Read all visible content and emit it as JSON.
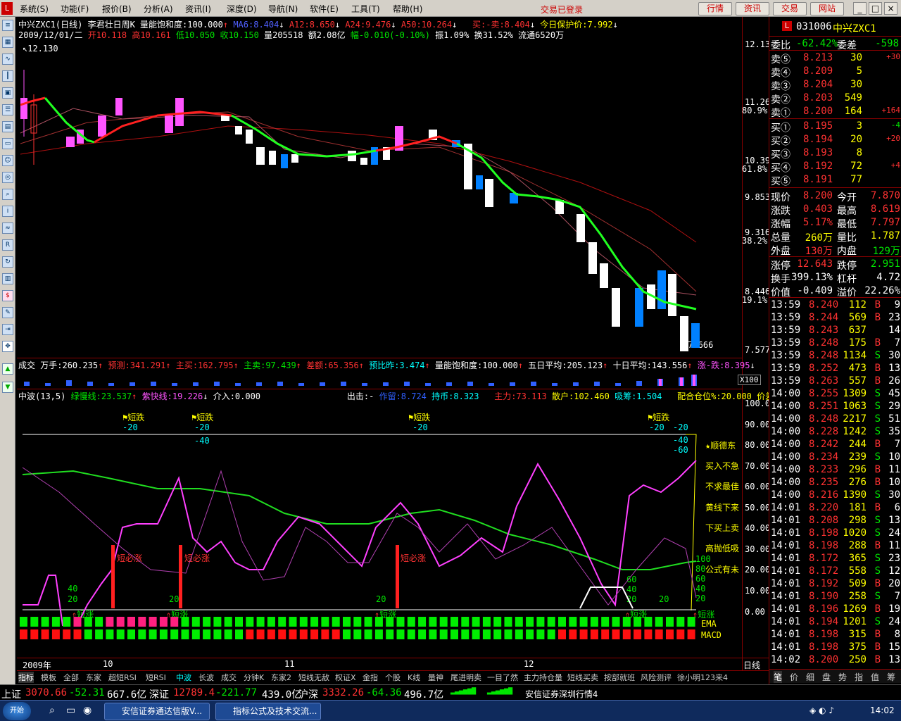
{
  "menu": {
    "items": [
      "系统(S)",
      "功能(F)",
      "报价(B)",
      "分析(A)",
      "资讯(I)",
      "深度(D)",
      "导航(N)",
      "软件(E)",
      "工具(T)",
      "帮助(H)"
    ],
    "trade_status": "交易已登录",
    "buttons": [
      "行情",
      "资讯",
      "交易",
      "网站"
    ]
  },
  "chart_header": {
    "line1": {
      "title": "中兴ZXC1(日线) 李君壮日周K",
      "saturation": "量能饱和度:100.000",
      "ma6": "MA6:8.404",
      "a12": "A12:8.650",
      "a24": "A24:9.476",
      "a50": "A50:10.264",
      "buysell": "买:-卖:8.404",
      "protect": "今日保护价:7.992"
    },
    "line2": {
      "date": "2009/12/01/二",
      "open": "开10.118",
      "high": "高10.161",
      "low": "低10.050",
      "close": "收10.150",
      "vol": "量205518",
      "amount": "额2.08亿",
      "change": "幅-0.010(-0.10%)",
      "amp": "振1.09%",
      "turnover": "换31.52%",
      "float": "流通6520万"
    },
    "high_marker": "12.130",
    "low_marker": "7.666"
  },
  "price_axis": [
    {
      "v": "12.13"
    },
    {
      "v": "11.26",
      "p": "80.9%"
    },
    {
      "v": "10.39",
      "p": "61.8%"
    },
    {
      "v": "9.853"
    },
    {
      "v": "9.316",
      "p": "38.2%"
    },
    {
      "v": "8.446",
      "p": "19.1%"
    },
    {
      "v": "7.577"
    }
  ],
  "vol_header": {
    "label": "成交",
    "wanshou": "万手:260.235",
    "predict": "预测:341.291",
    "mainbuy": "主买:162.795",
    "mainsell": "主卖:97.439",
    "diff": "差额:65.356",
    "ratio": "预比昨:3.474",
    "sat": "量能饱和度:100.000",
    "ma5": "五日平均:205.123",
    "ma10": "十日平均:143.556",
    "rise": "涨-跌:8.395",
    "x100": "X100"
  },
  "ind_header": {
    "name": "中波(13,5)",
    "green": "绿慢线:23.537",
    "purple": "紫快线:19.226",
    "enter": "介入:0.000",
    "out": "出击:-",
    "work": "作留:8.724",
    "hold": "持币:8.323",
    "main": "主力:73.113",
    "retail": "散户:102.460",
    "absorb": "吸筹:1.504",
    "pos": "配合仓位%:20.000",
    "pdiff": "价差20:-4."
  },
  "ind_axis": [
    "100.0",
    "90.00",
    "80.00",
    "70.00",
    "60.00",
    "50.00",
    "40.00",
    "30.00",
    "20.00",
    "10.00",
    "0.00"
  ],
  "ind_signals": {
    "short_fall": "短跌",
    "short_rise": "短涨",
    "must_rise": "短必涨",
    "m20": "-20",
    "m40": "-40",
    "m60": "-60",
    "p20": "20",
    "p40": "40",
    "p60": "60",
    "p80": "80",
    "p100": "100",
    "ema": "EMA",
    "macd": "MACD"
  },
  "ind_notes": [
    "★顺德东",
    "买入不急",
    "不求最佳",
    "黄线下来",
    "下买上卖",
    "高抛低吸",
    "公式有未"
  ],
  "time_axis": {
    "year": "2009年",
    "m10": "10",
    "m11": "11",
    "m12": "12",
    "period": "日线"
  },
  "bottom_tabs": [
    "指标",
    "模板",
    "全部",
    "东家",
    "超短RSI",
    "短RSI",
    "中波",
    "长波",
    "成交",
    "分钟K",
    "东家2",
    "短线无敌",
    "权证X",
    "金指",
    "个股",
    "K线",
    "量神",
    "尾进明卖",
    "一目了然",
    "主力持仓量",
    "短线买卖",
    "按部就班",
    "风险测评",
    "徐小明123来4"
  ],
  "quote": {
    "code": "031006",
    "name": "中兴ZXC1",
    "committee": {
      "ratio_label": "委比",
      "ratio": "-62.42%",
      "diff_label": "委差",
      "diff": "-598"
    },
    "asks": [
      {
        "l": "卖⑤",
        "p": "8.213",
        "v": "30",
        "c": "+30"
      },
      {
        "l": "卖④",
        "p": "8.209",
        "v": "5",
        "c": ""
      },
      {
        "l": "卖③",
        "p": "8.204",
        "v": "30",
        "c": ""
      },
      {
        "l": "卖②",
        "p": "8.203",
        "v": "549",
        "c": ""
      },
      {
        "l": "卖①",
        "p": "8.200",
        "v": "164",
        "c": "+164"
      }
    ],
    "bids": [
      {
        "l": "买①",
        "p": "8.195",
        "v": "3",
        "c": "-4"
      },
      {
        "l": "买②",
        "p": "8.194",
        "v": "20",
        "c": "+20"
      },
      {
        "l": "买③",
        "p": "8.193",
        "v": "8",
        "c": ""
      },
      {
        "l": "买④",
        "p": "8.192",
        "v": "72",
        "c": "+4"
      },
      {
        "l": "买⑤",
        "p": "8.191",
        "v": "77",
        "c": ""
      }
    ],
    "stats": [
      {
        "l1": "现价",
        "v1": "8.200",
        "l2": "今开",
        "v2": "7.870"
      },
      {
        "l1": "涨跌",
        "v1": "0.403",
        "l2": "最高",
        "v2": "8.619"
      },
      {
        "l1": "涨幅",
        "v1": "5.17%",
        "l2": "最低",
        "v2": "7.797"
      },
      {
        "l1": "总量",
        "v1": "260万",
        "l2": "量比",
        "v2": "1.787"
      },
      {
        "l1": "外盘",
        "v1": "130万",
        "l2": "内盘",
        "v2": "129万"
      }
    ],
    "stats2": [
      {
        "l1": "涨停",
        "v1": "12.643",
        "l2": "跌停",
        "v2": "2.951"
      },
      {
        "l1": "换手",
        "v1": "399.13%",
        "l2": "杠杆",
        "v2": "4.72"
      },
      {
        "l1": "价值",
        "v1": "-0.409",
        "l2": "溢价",
        "v2": "22.26%"
      }
    ],
    "ticks": [
      {
        "t": "13:59",
        "p": "8.240",
        "v": "112",
        "d": "B",
        "n": "9"
      },
      {
        "t": "13:59",
        "p": "8.244",
        "v": "569",
        "d": "B",
        "n": "23"
      },
      {
        "t": "13:59",
        "p": "8.243",
        "v": "637",
        "d": "",
        "n": "14"
      },
      {
        "t": "13:59",
        "p": "8.248",
        "v": "175",
        "d": "B",
        "n": "7"
      },
      {
        "t": "13:59",
        "p": "8.248",
        "v": "1134",
        "d": "S",
        "n": "30"
      },
      {
        "t": "13:59",
        "p": "8.252",
        "v": "473",
        "d": "B",
        "n": "13"
      },
      {
        "t": "13:59",
        "p": "8.263",
        "v": "557",
        "d": "B",
        "n": "26"
      },
      {
        "t": "14:00",
        "p": "8.255",
        "v": "1309",
        "d": "S",
        "n": "45"
      },
      {
        "t": "14:00",
        "p": "8.251",
        "v": "1063",
        "d": "S",
        "n": "29"
      },
      {
        "t": "14:00",
        "p": "8.248",
        "v": "2217",
        "d": "S",
        "n": "51"
      },
      {
        "t": "14:00",
        "p": "8.228",
        "v": "1242",
        "d": "S",
        "n": "35"
      },
      {
        "t": "14:00",
        "p": "8.242",
        "v": "244",
        "d": "B",
        "n": "7"
      },
      {
        "t": "14:00",
        "p": "8.234",
        "v": "239",
        "d": "S",
        "n": "10"
      },
      {
        "t": "14:00",
        "p": "8.233",
        "v": "296",
        "d": "B",
        "n": "11"
      },
      {
        "t": "14:00",
        "p": "8.235",
        "v": "276",
        "d": "B",
        "n": "10"
      },
      {
        "t": "14:00",
        "p": "8.216",
        "v": "1390",
        "d": "S",
        "n": "30"
      },
      {
        "t": "14:01",
        "p": "8.220",
        "v": "181",
        "d": "B",
        "n": "6"
      },
      {
        "t": "14:01",
        "p": "8.208",
        "v": "298",
        "d": "S",
        "n": "13"
      },
      {
        "t": "14:01",
        "p": "8.198",
        "v": "1020",
        "d": "S",
        "n": "24"
      },
      {
        "t": "14:01",
        "p": "8.198",
        "v": "288",
        "d": "B",
        "n": "11"
      },
      {
        "t": "14:01",
        "p": "8.172",
        "v": "365",
        "d": "S",
        "n": "23"
      },
      {
        "t": "14:01",
        "p": "8.172",
        "v": "558",
        "d": "S",
        "n": "12"
      },
      {
        "t": "14:01",
        "p": "8.192",
        "v": "509",
        "d": "B",
        "n": "20"
      },
      {
        "t": "14:01",
        "p": "8.190",
        "v": "258",
        "d": "S",
        "n": "7"
      },
      {
        "t": "14:01",
        "p": "8.196",
        "v": "1269",
        "d": "B",
        "n": "19"
      },
      {
        "t": "14:01",
        "p": "8.194",
        "v": "1201",
        "d": "S",
        "n": "24"
      },
      {
        "t": "14:01",
        "p": "8.198",
        "v": "315",
        "d": "B",
        "n": "8"
      },
      {
        "t": "14:01",
        "p": "8.198",
        "v": "375",
        "d": "B",
        "n": "15"
      },
      {
        "t": "14:02",
        "p": "8.200",
        "v": "250",
        "d": "B",
        "n": "13"
      }
    ],
    "side_tabs": [
      "笔",
      "价",
      "细",
      "盘",
      "势",
      "指",
      "值",
      "筹"
    ]
  },
  "status": {
    "sh_label": "上证",
    "sh": "3070.66",
    "sh_chg": "-52.31",
    "sh_amt": "667.6亿",
    "sz_label": "深证",
    "sz": "12789.4",
    "sz_chg": "-221.77",
    "sz_amt": "439.0亿",
    "hs_label": "沪深",
    "hs": "3332.26",
    "hs_chg": "-64.36",
    "hs_amt": "496.7亿",
    "source": "安信证券深圳行情4"
  },
  "taskbar": {
    "start": "开始",
    "tasks": [
      "安信证券通达信版V...",
      "指标公式及技术交流..."
    ],
    "clock": "14:02"
  }
}
